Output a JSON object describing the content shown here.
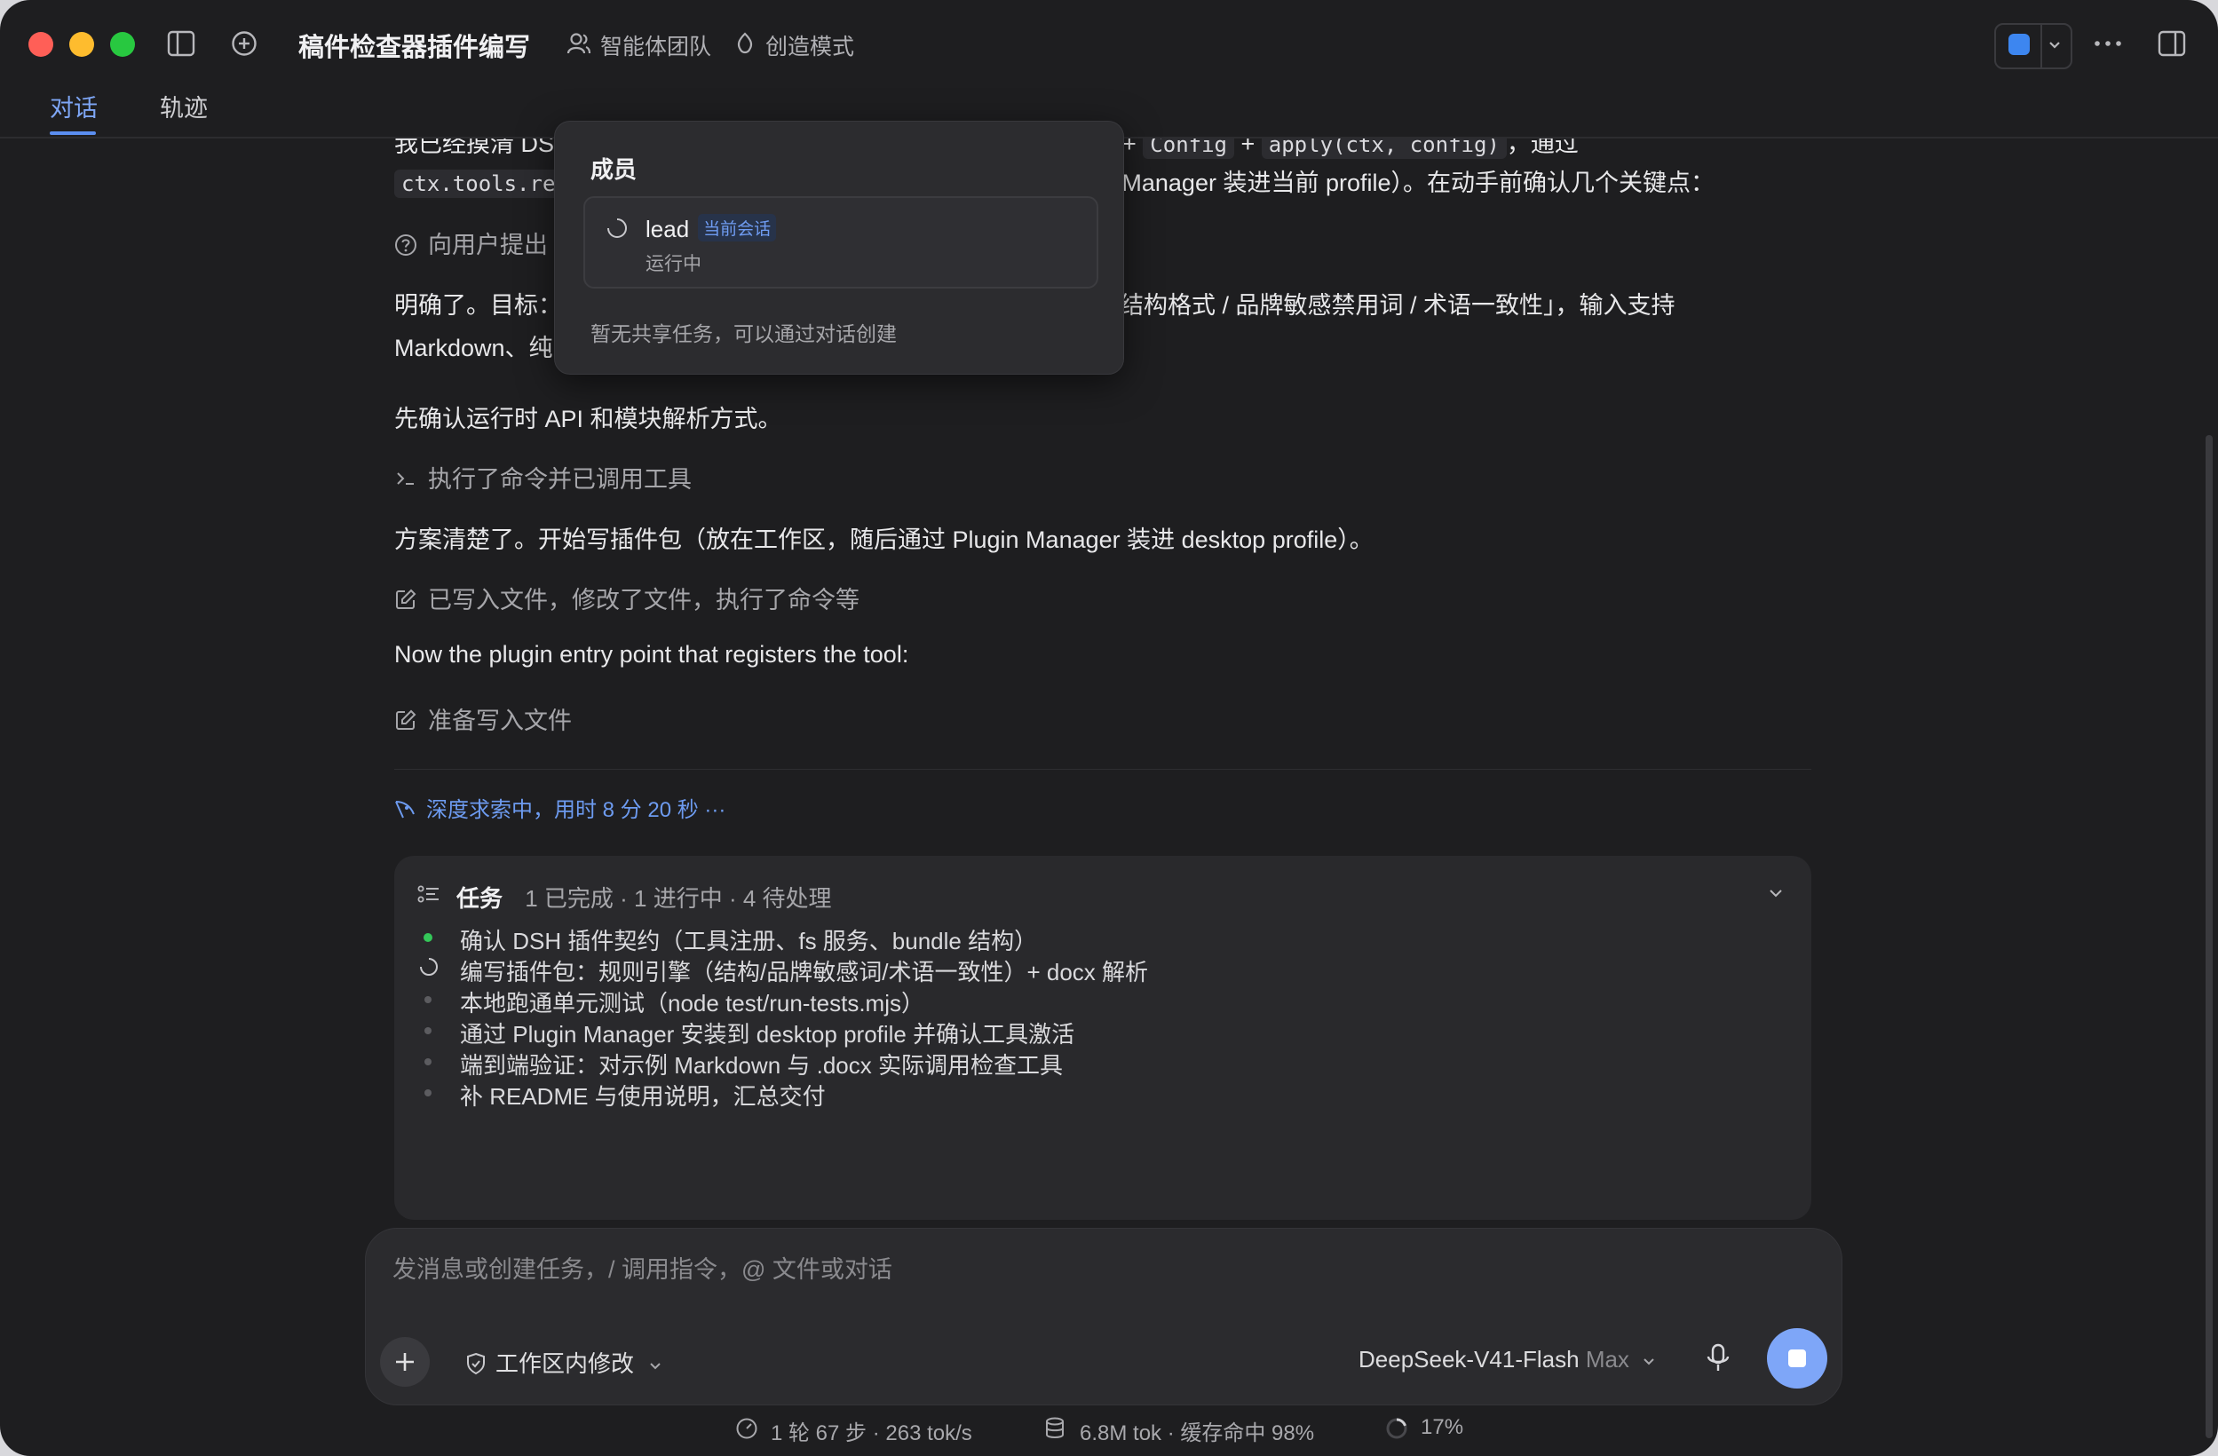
{
  "window": {
    "title": "稿件检查器插件编写",
    "chips": [
      "智能体团队",
      "创造模式"
    ]
  },
  "tabs": [
    "对话",
    "轨迹"
  ],
  "popup": {
    "heading": "成员",
    "member": {
      "name": "lead",
      "badge": "当前会话",
      "status": "运行中"
    },
    "empty": "暂无共享任务，可以通过对话创建"
  },
  "conversation": {
    "line1_prefix": "我已经摸清 DS",
    "line1_code1": "Config",
    "line1_code2": "apply(ctx, config)",
    "line1_suffix": "，通过",
    "line2_code": "ctx.tools.re",
    "line2_suffix": "Manager 装进当前 profile）。在动手前确认几个关键点：",
    "ask_user": "向用户提出",
    "goal_prefix": "明确了。目标：",
    "goal_suffix": "结构格式 / 品牌敏感禁用词 / 术语一致性」，输入支持",
    "goal_line2": "Markdown、纯",
    "confirm_api": "先确认运行时 API 和模块解析方式。",
    "tool_exec": "执行了命令并已调用工具",
    "plan": "方案清楚了。开始写插件包（放在工作区，随后通过 Plugin Manager 装进 desktop profile）。",
    "files_done": "已写入文件，修改了文件，执行了命令等",
    "entry_point": "Now the plugin entry point that registers the tool:",
    "writing_file": "准备写入文件",
    "deep_search": "深度求索中，用时 8 分 20 秒 ···"
  },
  "tasks": {
    "title": "任务",
    "summary": "1 已完成 · 1 进行中 · 4 待处理",
    "items": [
      {
        "label": "确认 DSH 插件契约（工具注册、fs 服务、bundle 结构）",
        "state": "done"
      },
      {
        "label": "编写插件包：规则引擎（结构/品牌敏感词/术语一致性）+ docx 解析",
        "state": "running"
      },
      {
        "label": "本地跑通单元测试（node test/run-tests.mjs）",
        "state": "pending"
      },
      {
        "label": "通过 Plugin Manager 安装到 desktop profile 并确认工具激活",
        "state": "pending"
      },
      {
        "label": "端到端验证：对示例 Markdown 与 .docx 实际调用检查工具",
        "state": "pending"
      },
      {
        "label": "补 README 与使用说明，汇总交付",
        "state": "pending"
      }
    ]
  },
  "composer": {
    "placeholder": "发消息或创建任务，/ 调用指令，@ 文件或对话",
    "scope": "工作区内修改",
    "model": "DeepSeek-V41-Flash",
    "model_level": "Max"
  },
  "status": {
    "steps": "1 轮 67 步",
    "speed": "263 tok/s",
    "tokens": "6.8M tok",
    "cache": "缓存命中 98%",
    "context": "17%"
  },
  "colors": {
    "accent": "#5b8ef0",
    "done": "#34c759",
    "close": "#ff5f57",
    "minimize": "#febc2e",
    "zoom": "#28c840"
  }
}
